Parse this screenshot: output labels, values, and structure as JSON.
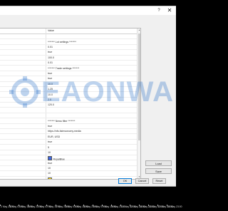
{
  "dialog": {
    "help_icon": "question-mark-icon",
    "close_icon": "close-icon",
    "grid": {
      "value_header": "Value",
      "rows": [
        {
          "value": "",
          "swatch": null
        },
        {
          "value": "******* Lot settings *******",
          "swatch": null
        },
        {
          "value": "0.01",
          "swatch": null
        },
        {
          "value": "true",
          "swatch": null
        },
        {
          "value": "100.0",
          "swatch": null
        },
        {
          "value": "0.01",
          "swatch": null
        },
        {
          "value": "******* Trade settings *******",
          "swatch": null
        },
        {
          "value": "true",
          "swatch": null
        },
        {
          "value": "true",
          "swatch": null
        },
        {
          "value": "10.0",
          "swatch": null
        },
        {
          "value": "1.25",
          "swatch": null
        },
        {
          "value": "10.0",
          "swatch": null
        },
        {
          "value": "2.0",
          "swatch": null
        },
        {
          "value": "120.0",
          "swatch": null
        },
        {
          "value": "",
          "swatch": null
        },
        {
          "value": "",
          "swatch": null
        },
        {
          "value": "******* News filter *******",
          "swatch": null
        },
        {
          "value": "true",
          "swatch": null
        },
        {
          "value": "https://nfs.faireconomy.media",
          "swatch": null
        },
        {
          "value": "EUR, USD",
          "swatch": null
        },
        {
          "value": "true",
          "swatch": null
        },
        {
          "value": "5",
          "swatch": null
        },
        {
          "value": "10",
          "swatch": null
        },
        {
          "value": "RoyalBlue",
          "swatch": "#4169E1"
        },
        {
          "value": "true",
          "swatch": null
        },
        {
          "value": "10",
          "swatch": null
        },
        {
          "value": "10",
          "swatch": null
        },
        {
          "value": "Gold",
          "swatch": "#FFD700"
        },
        {
          "value": "true",
          "swatch": null
        },
        {
          "value": "30",
          "swatch": null
        }
      ]
    },
    "side_buttons": {
      "load": "Load",
      "save": "Save"
    },
    "footer_buttons": {
      "ok": "OK",
      "cancel": "Cancel",
      "reset": "Reset"
    }
  },
  "watermark": {
    "text": "EAONWA"
  },
  "time_axis": {
    "labels": [
      "2 May 2024",
      "6 May 07:00",
      "6 May 15:00",
      "6 May 23:00",
      "7 May 07:00",
      "7 May 15:00",
      "7 May 23:00",
      "8 May 07:00",
      "8 May 15:00",
      "8 May 23:00",
      "9 May 07:00",
      "9 May 15:00",
      "9 May 23:00",
      "10 May 07:00",
      "10 May 15:00",
      "10 May 23:00",
      "13 May 07:00",
      "13 May 15:00",
      "13 May 23:00"
    ]
  },
  "colors": {
    "chart_background": "#000000",
    "dialog_background": "#f0f0f0",
    "grid_background": "#ffffff",
    "watermark": "#266ec8",
    "primary_button_border": "#0078d7"
  }
}
